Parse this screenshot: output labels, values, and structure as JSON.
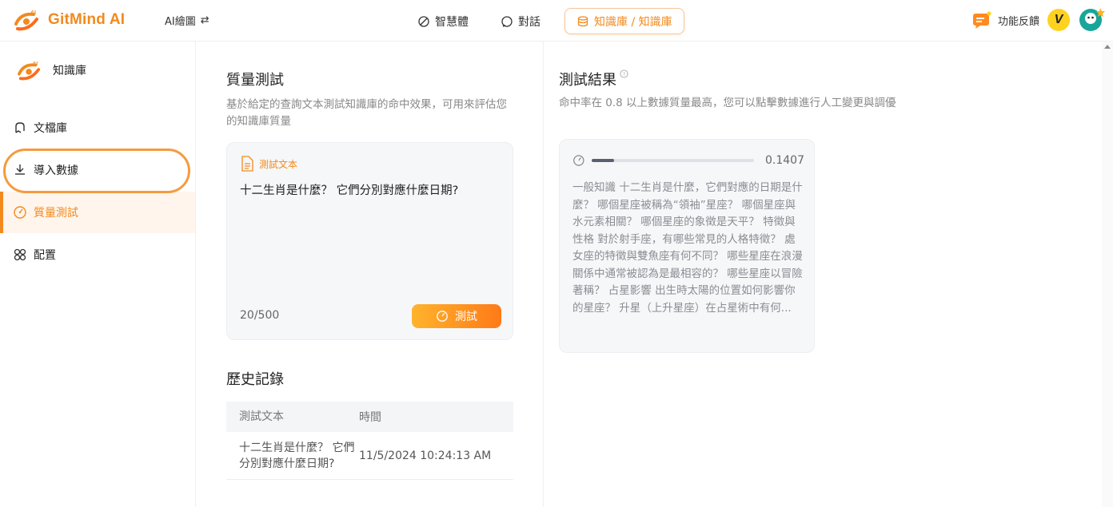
{
  "header": {
    "logo_text": "GitMind AI",
    "ai_draw": "AI繪圖",
    "nav": [
      {
        "label": "智慧體"
      },
      {
        "label": "對話"
      },
      {
        "label": "知識庫 / 知識庫"
      }
    ],
    "feedback": "功能反饋",
    "avatar_letter": "V"
  },
  "sidebar": {
    "title": "知識庫",
    "items": [
      {
        "label": "文檔庫"
      },
      {
        "label": "導入數據"
      },
      {
        "label": "質量測試"
      },
      {
        "label": "配置"
      }
    ]
  },
  "quality_test": {
    "title": "質量測試",
    "description": "基於給定的查詢文本測試知識庫的命中效果，可用來評估您的知識庫質量",
    "label": "測試文本",
    "text": "十二生肖是什麼？ 它們分別對應什麼日期?",
    "count": "20/500",
    "button": "測試"
  },
  "history": {
    "title": "歷史記錄",
    "headers": [
      "測試文本",
      "時間"
    ],
    "rows": [
      {
        "text": "十二生肖是什麼？ 它們分別對應什麼日期?",
        "time": "11/5/2024 10:24:13 AM"
      }
    ]
  },
  "result": {
    "title": "測試結果",
    "description": "命中率在 0.8 以上數據質量最高，您可以點擊數據進行人工變更與調優",
    "score": "0.1407",
    "score_value": 0.1407,
    "text": "一般知識 十二生肖是什麼，它們對應的日期是什麼？ 哪個星座被稱為“領袖”星座？ 哪個星座與水元素相關？ 哪個星座的象徵是天平？ 特徵與性格 對於射手座，有哪些常見的人格特徵？ 處女座的特徵與雙魚座有何不同？ 哪些星座在浪漫關係中通常被認為是最相容的？ 哪些星座以冒險著稱？ 占星影響 出生時太陽的位置如何影響你的星座？ 升星（上升星座）在占星術中有何..."
  },
  "colors": {
    "accent": "#f28a1d",
    "accent_light": "#fff5ec"
  }
}
